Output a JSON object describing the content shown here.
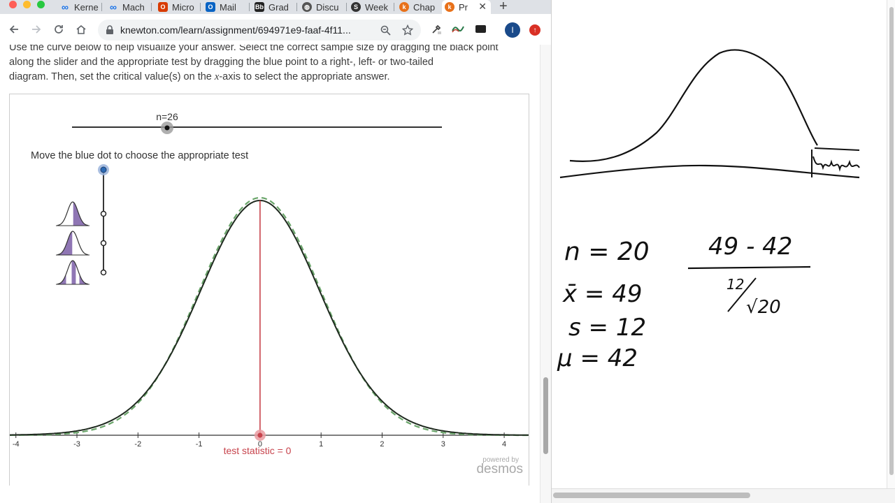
{
  "browser": {
    "tabs": [
      {
        "label": "Kerne",
        "icon": "infinity-icon",
        "color": "#1a73e8"
      },
      {
        "label": "Mach",
        "icon": "infinity-icon",
        "color": "#1a73e8"
      },
      {
        "label": "Micro",
        "icon": "office-icon",
        "color": "#d83b01"
      },
      {
        "label": "Mail",
        "icon": "outlook-icon",
        "color": "#0a64c4"
      },
      {
        "label": "Grad",
        "icon": "blackboard-icon",
        "color": "#222222"
      },
      {
        "label": "Discu",
        "icon": "globe-icon",
        "color": "#444444"
      },
      {
        "label": "Week",
        "icon": "s-logo-icon",
        "color": "#333333"
      },
      {
        "label": "Chap",
        "icon": "knewton-icon",
        "color": "#e8711a"
      },
      {
        "label": "Pr",
        "icon": "knewton-icon",
        "color": "#e8711a",
        "active": true
      }
    ],
    "url": "knewton.com/learn/assignment/694971e9-faaf-4f11...",
    "profile_initial": "I"
  },
  "instructions": {
    "line1": "Use the curve below to help visualize your answer. Select the correct sample size by dragging the black point",
    "line2": "along the slider and the appropriate test by dragging the blue point to a right-, left- or two-tailed",
    "line3_pre": "diagram. Then, set the critical value(s) on the ",
    "line3_var": "x",
    "line3_post": "-axis to select the appropriate answer."
  },
  "graph": {
    "slider_label": "n=26",
    "sample_size": 26,
    "blue_dot_prompt": "Move the blue dot to choose the appropriate test",
    "test_statistic_label": "test statistic = 0",
    "test_statistic": 0,
    "x_ticks": [
      "-4",
      "-3",
      "-2",
      "-1",
      "0",
      "1",
      "2",
      "3",
      "4"
    ],
    "xlim": [
      -4.1,
      4.4
    ],
    "powered_by": "powered by",
    "brand": "desmos",
    "colors": {
      "curve": "#1f2a1f",
      "dashed": "#6aa56a",
      "teststat": "#c7434c",
      "blue": "#2d6bb5",
      "tail": "#7b5ea7"
    }
  },
  "notes": {
    "n": "n = 20",
    "xbar": "x̄ = 49",
    "s": "s = 12",
    "mu": "μ = 42",
    "numerator": "49 - 42",
    "denominator_num": "12",
    "denominator_den": "√20"
  }
}
